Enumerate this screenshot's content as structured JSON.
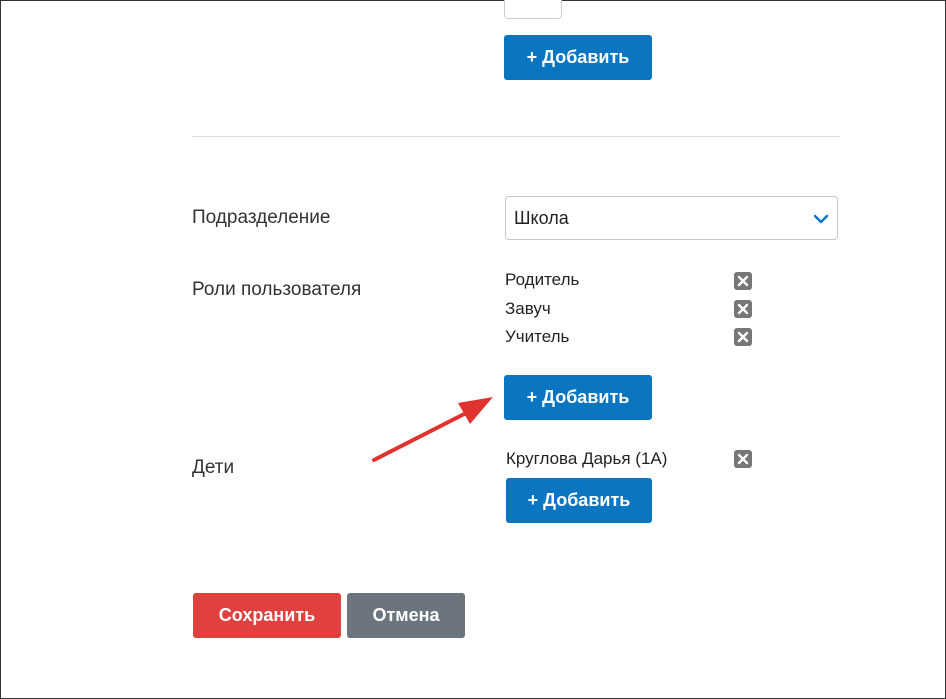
{
  "add_buttons": {
    "top_label": "+ Добавить",
    "roles_label": "+ Добавить",
    "children_label": "+ Добавить"
  },
  "department": {
    "label": "Подразделение",
    "selected": "Школа"
  },
  "roles": {
    "label": "Роли пользователя",
    "items": [
      "Родитель",
      "Завуч",
      "Учитель"
    ]
  },
  "children": {
    "label": "Дети",
    "items": [
      "Круглова Дарья (1А)"
    ]
  },
  "actions": {
    "save_label": "Сохранить",
    "cancel_label": "Отмена"
  },
  "icons": {
    "remove": "close-icon",
    "select": "chevron-down-icon",
    "annotation": "red-arrow"
  },
  "colors": {
    "primary": "#0a76c2",
    "danger": "#e0403e",
    "secondary": "#6c757d",
    "annotation": "#e0332f"
  }
}
